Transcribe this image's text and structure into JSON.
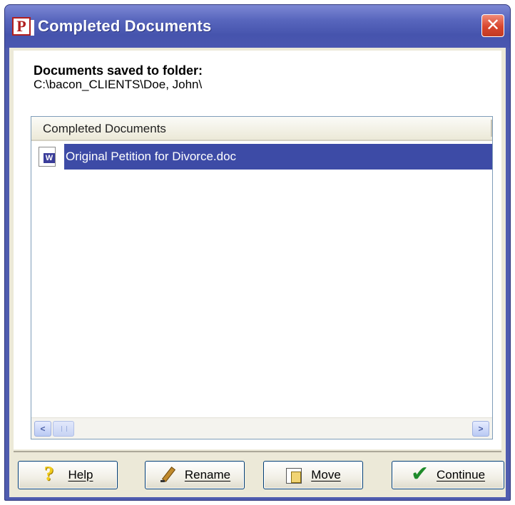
{
  "window": {
    "title": "Completed Documents",
    "app_icon_letter": "P",
    "close_glyph": "✕"
  },
  "panel": {
    "heading": "Documents saved to folder:",
    "folder_path": "C:\\bacon_CLIENTS\\Doe, John\\"
  },
  "list": {
    "column_header": "Completed Documents",
    "items": [
      {
        "label": "Original Petition for Divorce.doc",
        "icon": "word-document-icon",
        "selected": true
      }
    ],
    "scrollbar": {
      "left_glyph": "<",
      "right_glyph": ">"
    }
  },
  "buttons": {
    "help": {
      "label": "Help",
      "icon": "help-icon"
    },
    "rename": {
      "label": "Rename",
      "icon": "pencil-icon"
    },
    "move": {
      "label": "Move",
      "icon": "move-icon"
    },
    "continue": {
      "label": "Continue",
      "icon": "checkmark-icon"
    }
  },
  "colors": {
    "titlebar": "#4654ad",
    "selection": "#3d4ba6",
    "close_button": "#d8462e",
    "dialog_face": "#ece9d8"
  }
}
